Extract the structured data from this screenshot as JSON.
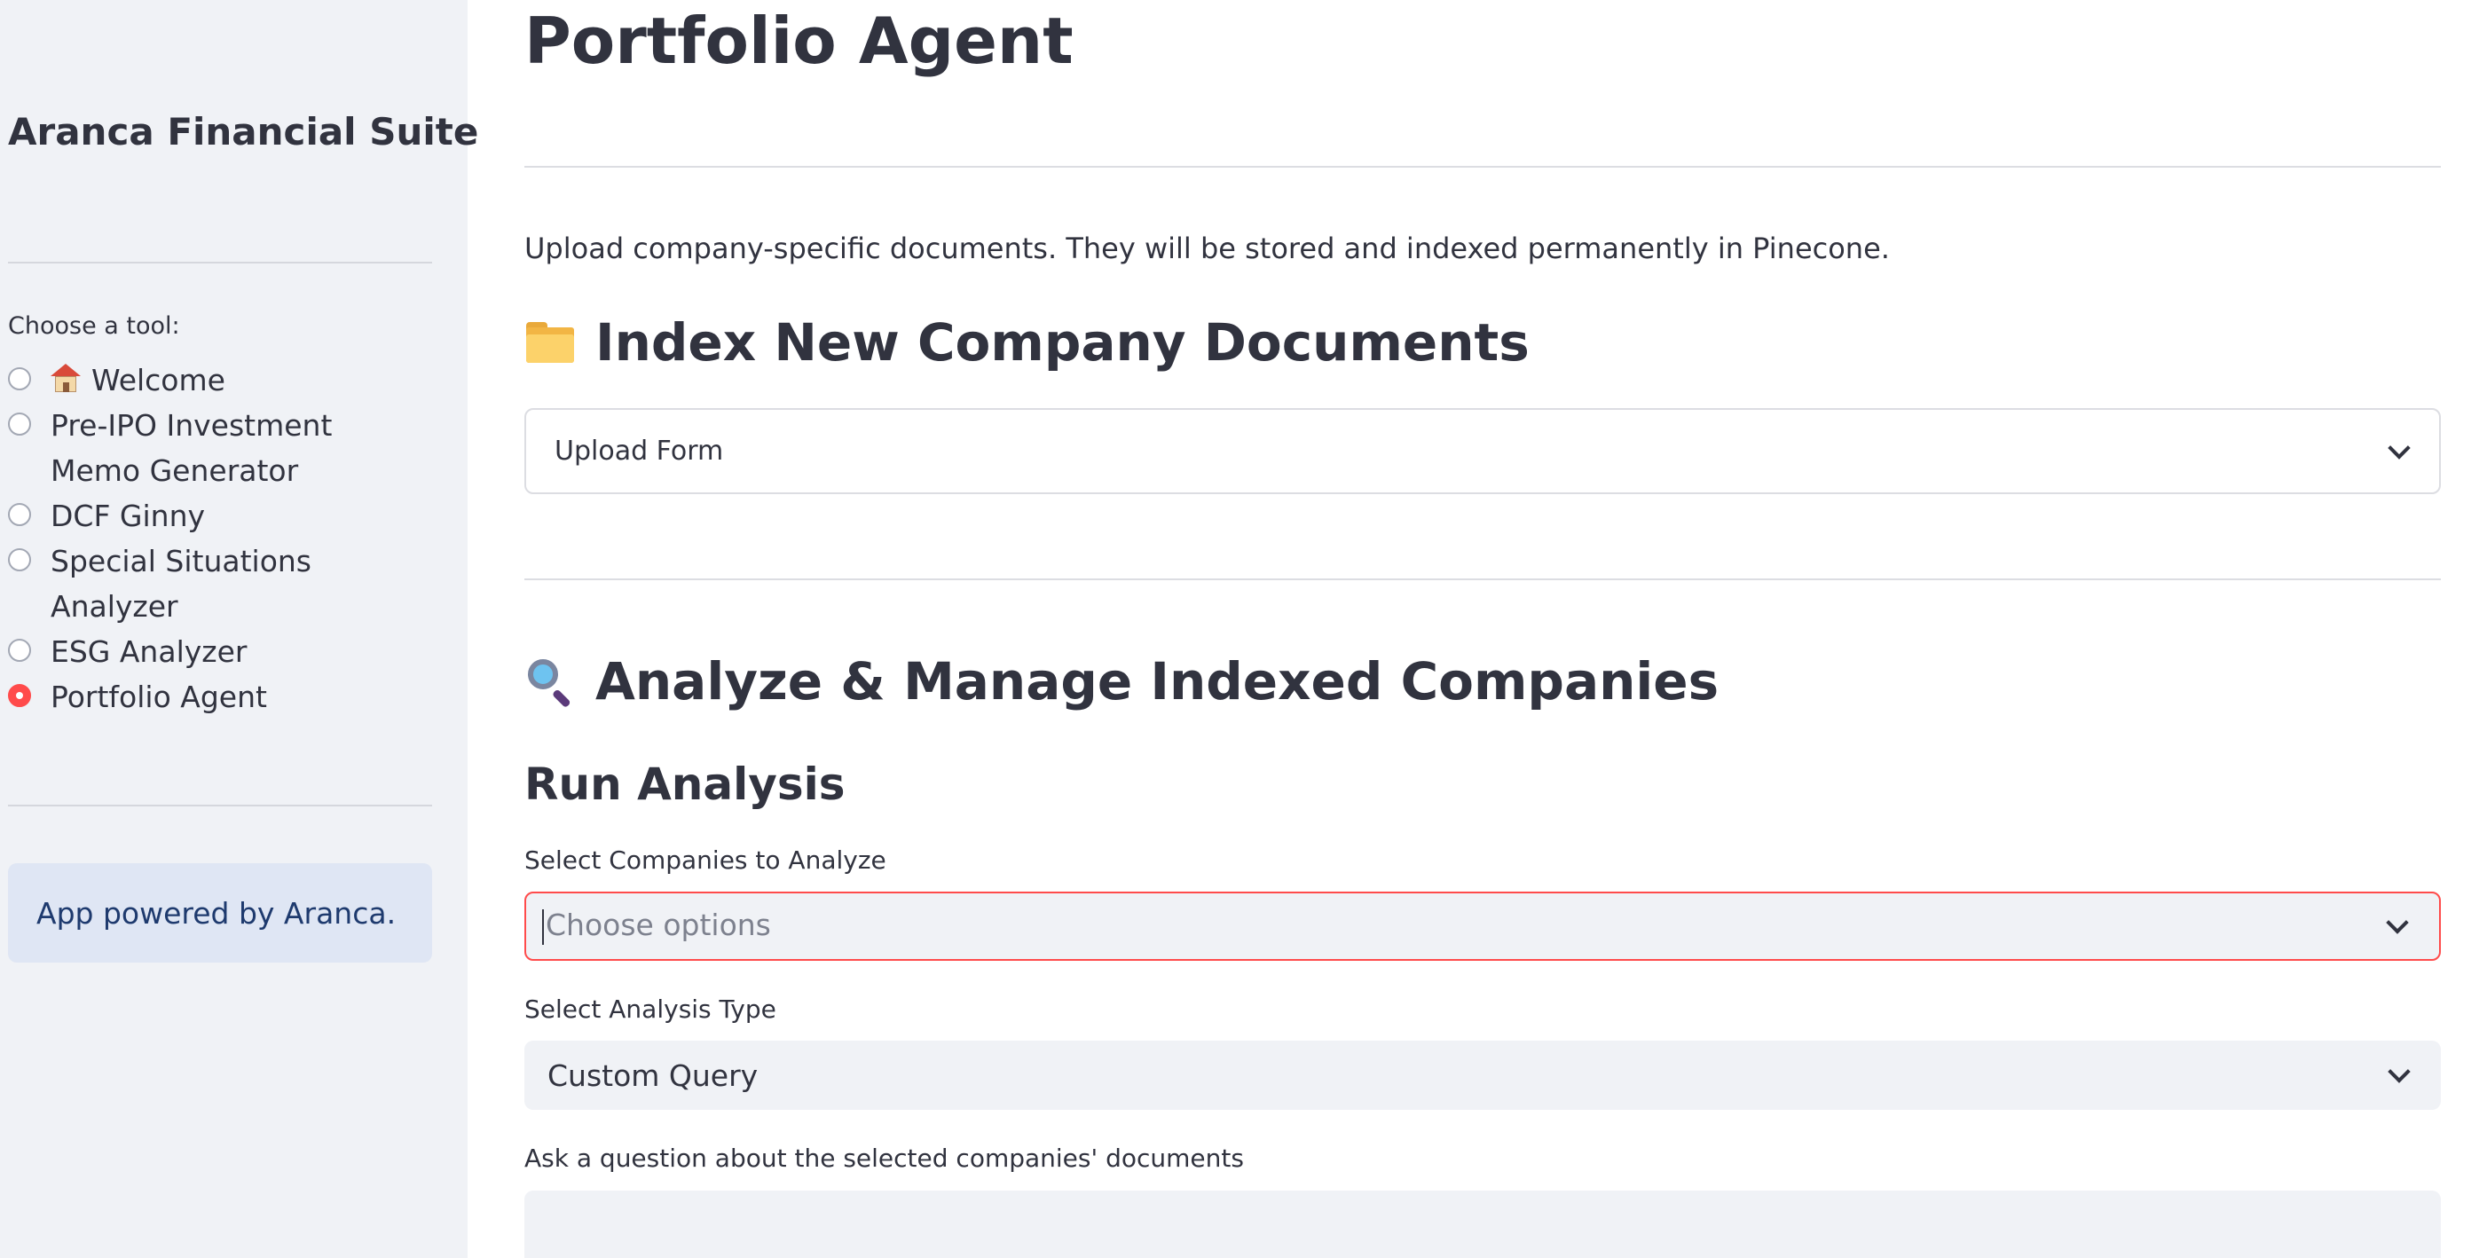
{
  "sidebar": {
    "title": "Aranca Financial Suite",
    "choose_label": "Choose a tool:",
    "tools": [
      {
        "label": "Welcome",
        "icon": "house-icon",
        "selected": false
      },
      {
        "label": "Pre-IPO Investment Memo Generator",
        "selected": false
      },
      {
        "label": "DCF Ginny",
        "selected": false
      },
      {
        "label": "Special Situations Analyzer",
        "selected": false
      },
      {
        "label": "ESG Analyzer",
        "selected": false
      },
      {
        "label": "Portfolio Agent",
        "selected": true
      }
    ],
    "info_text": "App powered by Aranca."
  },
  "main": {
    "title": "Portfolio Agent",
    "intro": "Upload company-specific documents. They will be stored and indexed permanently in Pinecone.",
    "index_section": {
      "icon": "folder-icon",
      "heading": "Index New Company Documents",
      "expander_label": "Upload Form"
    },
    "analyze_section": {
      "icon": "magnifier-icon",
      "heading": "Analyze & Manage Indexed Companies",
      "subheading": "Run Analysis",
      "companies_label": "Select Companies to Analyze",
      "companies_placeholder": "Choose options",
      "analysis_type_label": "Select Analysis Type",
      "analysis_type_value": "Custom Query",
      "question_label": "Ask a question about the selected companies' documents",
      "question_value": ""
    }
  },
  "colors": {
    "accent": "#ff4b4b",
    "sidebar_bg": "#f0f2f6",
    "info_bg": "#dfe6f4",
    "info_text": "#1e3a6e",
    "text": "#31333f"
  }
}
